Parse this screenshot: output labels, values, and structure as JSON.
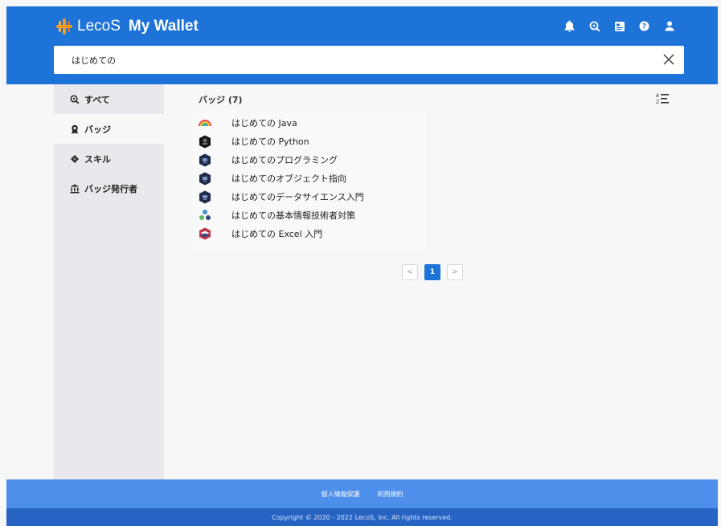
{
  "header": {
    "brand": "LecoS",
    "app_title": "My Wallet",
    "icons": [
      "bell-icon",
      "search-circle-icon",
      "id-card-icon",
      "help-icon",
      "user-icon"
    ],
    "brand_color": "#1d73d8",
    "logo_color": "#f39a1e"
  },
  "search": {
    "value": "はじめての",
    "clear_icon": "close-icon"
  },
  "sidebar": {
    "items": [
      {
        "label": "すべて",
        "icon": "search-icon",
        "active": false
      },
      {
        "label": "バッジ",
        "icon": "badge-icon",
        "active": true
      },
      {
        "label": "スキル",
        "icon": "diamond-icon",
        "active": false
      },
      {
        "label": "バッジ発行者",
        "icon": "bank-icon",
        "active": false
      }
    ]
  },
  "main": {
    "section_title": "バッジ (7)",
    "sort_icon": "sort-icon",
    "badges": [
      {
        "label": "はじめての Java",
        "icon": "rainbow-icon"
      },
      {
        "label": "はじめての Python",
        "icon": "python-badge-icon"
      },
      {
        "label": "はじめてのプログラミング",
        "icon": "navy-badge-icon"
      },
      {
        "label": "はじめてのオブジェクト指向",
        "icon": "navy-badge-icon"
      },
      {
        "label": "はじめてのデータサイエンス入門",
        "icon": "navy-badge-icon"
      },
      {
        "label": "はじめての基本情報技術者対策",
        "icon": "people-icon"
      },
      {
        "label": "はじめての Excel 入門",
        "icon": "layered-shield-icon"
      }
    ]
  },
  "pagination": {
    "prev": "<",
    "current": "1",
    "next": ">"
  },
  "footer": {
    "links": [
      "個人情報保護",
      "利用規約"
    ],
    "copyright": "Copyright © 2020 - 2022 LecoS, Inc. All rights reserved."
  }
}
